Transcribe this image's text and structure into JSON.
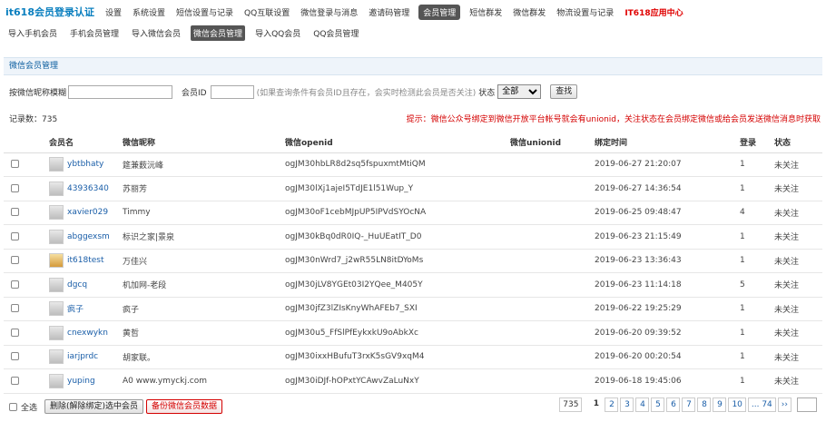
{
  "topnav": {
    "brand": "it618会员登录认证",
    "items": [
      "设置",
      "系统设置",
      "短信设置与记录",
      "QQ互联设置",
      "微信登录与消息",
      "邀请码管理",
      "会员管理",
      "短信群发",
      "微信群发",
      "物流设置与记录",
      "IT618应用中心"
    ]
  },
  "subnav": {
    "items": [
      "导入手机会员",
      "手机会员管理",
      "导入微信会员",
      "微信会员管理",
      "导入QQ会员",
      "QQ会员管理"
    ]
  },
  "panel": {
    "title": "微信会员管理"
  },
  "filter": {
    "nickname_label": "按微信昵称模糊",
    "nickname_value": "",
    "uid_label": "会员ID",
    "uid_value": "",
    "uid_hint": "(如果查询条件有会员ID且存在，会实时检测此会员是否关注)",
    "status_label": "状态",
    "status_selected": "全部",
    "query_button": "查找"
  },
  "records": {
    "label": "记录数：",
    "count": "735"
  },
  "notice": "提示：微信公众号绑定到微信开放平台帐号就会有unionid，关注状态在会员绑定微信或给会员发送微信消息时获取",
  "table": {
    "headers": [
      "会员名",
      "微信昵称",
      "微信openid",
      "微信unionid",
      "绑定时间",
      "登录",
      "状态"
    ],
    "rows": [
      {
        "username": "ybtbhaty",
        "nickname": "筵兼薮沅峰",
        "openid": "ogJM30hbLR8d2sq5fspuxmtMtiQM",
        "unionid": "",
        "time": "2019-06-27 21:20:07",
        "logins": "1",
        "status": "未关注"
      },
      {
        "username": "43936340",
        "nickname": "苏丽芳",
        "openid": "ogJM30lXj1ajeI5TdJE1l51Wup_Y",
        "unionid": "",
        "time": "2019-06-27 14:36:54",
        "logins": "1",
        "status": "未关注"
      },
      {
        "username": "xavier029",
        "nickname": "Timmy",
        "openid": "ogJM30oF1cebMJpUP5IPVdSYOcNA",
        "unionid": "",
        "time": "2019-06-25 09:48:47",
        "logins": "4",
        "status": "未关注"
      },
      {
        "username": "abggexsm",
        "nickname": "标识之家|景泉",
        "openid": "ogJM30kBq0dR0IQ-_HuUEatIT_D0",
        "unionid": "",
        "time": "2019-06-23 21:15:49",
        "logins": "1",
        "status": "未关注"
      },
      {
        "username": "it618test",
        "nickname": "万佳兴",
        "openid": "ogJM30nWrd7_j2wR55LN8itDYoMs",
        "unionid": "",
        "time": "2019-06-23 13:36:43",
        "logins": "1",
        "status": "未关注"
      },
      {
        "username": "dgcq",
        "nickname": "机加网-老段",
        "openid": "ogJM30jLV8YGEt03I2YQee_M405Y",
        "unionid": "",
        "time": "2019-06-23 11:14:18",
        "logins": "5",
        "status": "未关注"
      },
      {
        "username": "疯子",
        "nickname": "疯子",
        "openid": "ogJM30jfZ3lZIsKnyWhAFEb7_SXI",
        "unionid": "",
        "time": "2019-06-22 19:25:29",
        "logins": "1",
        "status": "未关注"
      },
      {
        "username": "cnexwykn",
        "nickname": "黄哲",
        "openid": "ogJM30u5_FfSlPfEykxkU9oAbkXc",
        "unionid": "",
        "time": "2019-06-20 09:39:52",
        "logins": "1",
        "status": "未关注"
      },
      {
        "username": "iarjprdc",
        "nickname": "胡家联。",
        "openid": "ogJM30ixxHBufuT3rxK5sGV9xqM4",
        "unionid": "",
        "time": "2019-06-20 00:20:54",
        "logins": "1",
        "status": "未关注"
      },
      {
        "username": "yuping",
        "nickname": "A0 www.ymyckj.com",
        "openid": "ogJM30iDJf-hOPxtYCAwvZaLuNxY",
        "unionid": "",
        "time": "2019-06-18 19:45:06",
        "logins": "1",
        "status": "未关注"
      }
    ]
  },
  "footer": {
    "select_all_label": "全选",
    "delete_button": "删除(解除绑定)选中会员",
    "backup_button": "备份微信会员数据"
  },
  "pager": {
    "total": "735",
    "current": "1",
    "pages": [
      "2",
      "3",
      "4",
      "5",
      "6",
      "7",
      "8",
      "9",
      "10",
      "... 74",
      "››"
    ]
  },
  "colors": {
    "brand": "#0a7fbf",
    "accent_red": "#d40000",
    "active_bg": "#555555"
  },
  "icons": {
    "avatar": "avatar-icon",
    "checkbox": "checkbox-icon"
  }
}
